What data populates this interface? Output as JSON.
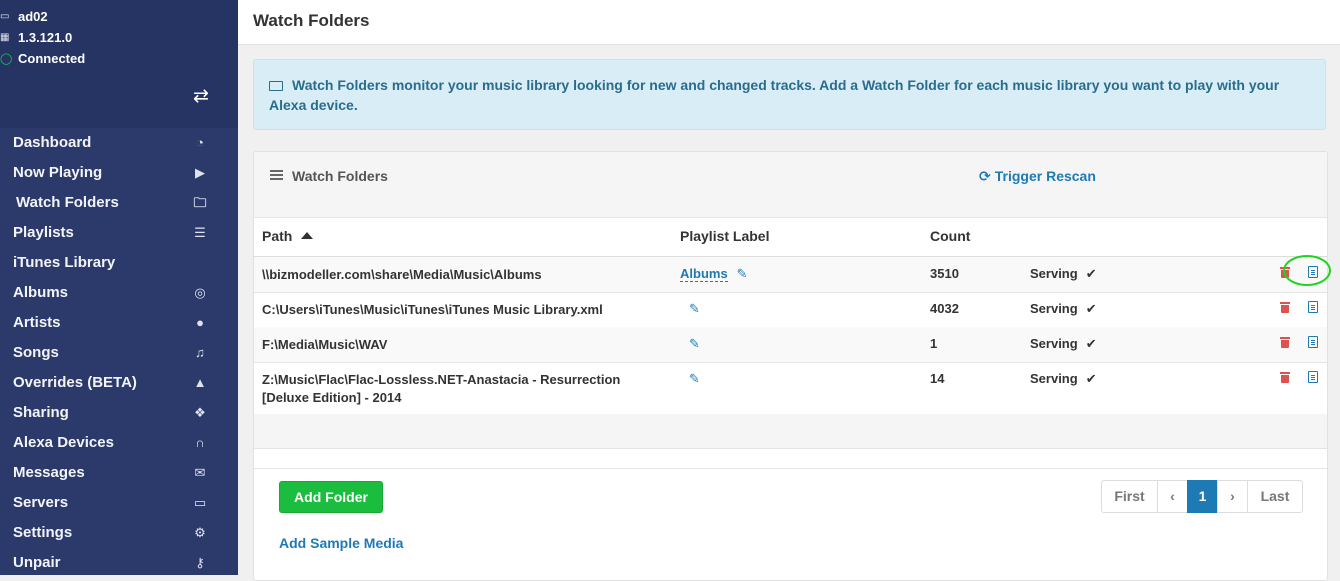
{
  "sidebar": {
    "info": {
      "host": "ad02",
      "version": "1.3.121.0",
      "status": "Connected"
    },
    "items": [
      {
        "label": "Dashboard",
        "icon": "dashboard-icon",
        "glyph": "◔"
      },
      {
        "label": "Now Playing",
        "icon": "play-icon",
        "glyph": "▶"
      },
      {
        "label": "Watch Folders",
        "icon": "folder-icon",
        "glyph": "🗀"
      },
      {
        "label": "Playlists",
        "icon": "list-icon",
        "glyph": "☰"
      },
      {
        "label": "iTunes Library",
        "icon": "apple-icon",
        "glyph": ""
      },
      {
        "label": "Albums",
        "icon": "disc-icon",
        "glyph": "◎"
      },
      {
        "label": "Artists",
        "icon": "user-icon",
        "glyph": "●"
      },
      {
        "label": "Songs",
        "icon": "music-icon",
        "glyph": "♫"
      },
      {
        "label": "Overrides (BETA)",
        "icon": "graduation-cap-icon",
        "glyph": "▲"
      },
      {
        "label": "Sharing",
        "icon": "users-icon",
        "glyph": "❖"
      },
      {
        "label": "Alexa Devices",
        "icon": "headphones-icon",
        "glyph": "∩"
      },
      {
        "label": "Messages",
        "icon": "envelope-icon",
        "glyph": "✉"
      },
      {
        "label": "Servers",
        "icon": "laptop-icon",
        "glyph": "▭"
      },
      {
        "label": "Settings",
        "icon": "gear-icon",
        "glyph": "⚙"
      },
      {
        "label": "Unpair",
        "icon": "key-icon",
        "glyph": "⚷"
      }
    ]
  },
  "header": {
    "title": "Watch Folders"
  },
  "alert": {
    "text": "Watch Folders monitor your music library looking for new and changed tracks. Add a Watch Folder for each music library you want to play with your Alexa device."
  },
  "panel": {
    "title": "Watch Folders",
    "rescan_label": "Trigger Rescan"
  },
  "table": {
    "columns": {
      "path": "Path",
      "label": "Playlist Label",
      "count": "Count"
    },
    "rows": [
      {
        "path": "\\\\bizmodeller.com\\share\\Media\\Music\\Albums",
        "label": "Albums",
        "count": "3510",
        "status": "Serving"
      },
      {
        "path": "C:\\Users\\iTunes\\Music\\iTunes\\iTunes Music Library.xml",
        "label": "",
        "count": "4032",
        "status": "Serving"
      },
      {
        "path": "F:\\Media\\Music\\WAV",
        "label": "",
        "count": "1",
        "status": "Serving"
      },
      {
        "path": "Z:\\Music\\Flac\\Flac-Lossless.NET-Anastacia - Resurrection [Deluxe Edition] - 2014",
        "label": "",
        "count": "14",
        "status": "Serving"
      }
    ]
  },
  "footer": {
    "add_folder": "Add Folder",
    "add_sample": "Add Sample Media"
  },
  "pager": {
    "first": "First",
    "prev": "‹",
    "current": "1",
    "next": "›",
    "last": "Last"
  },
  "colors": {
    "sidebar": "#2b3a6b",
    "accent": "#1e7ab5",
    "success": "#1bbd3f",
    "danger": "#d9534f",
    "highlight": "#21d321"
  }
}
